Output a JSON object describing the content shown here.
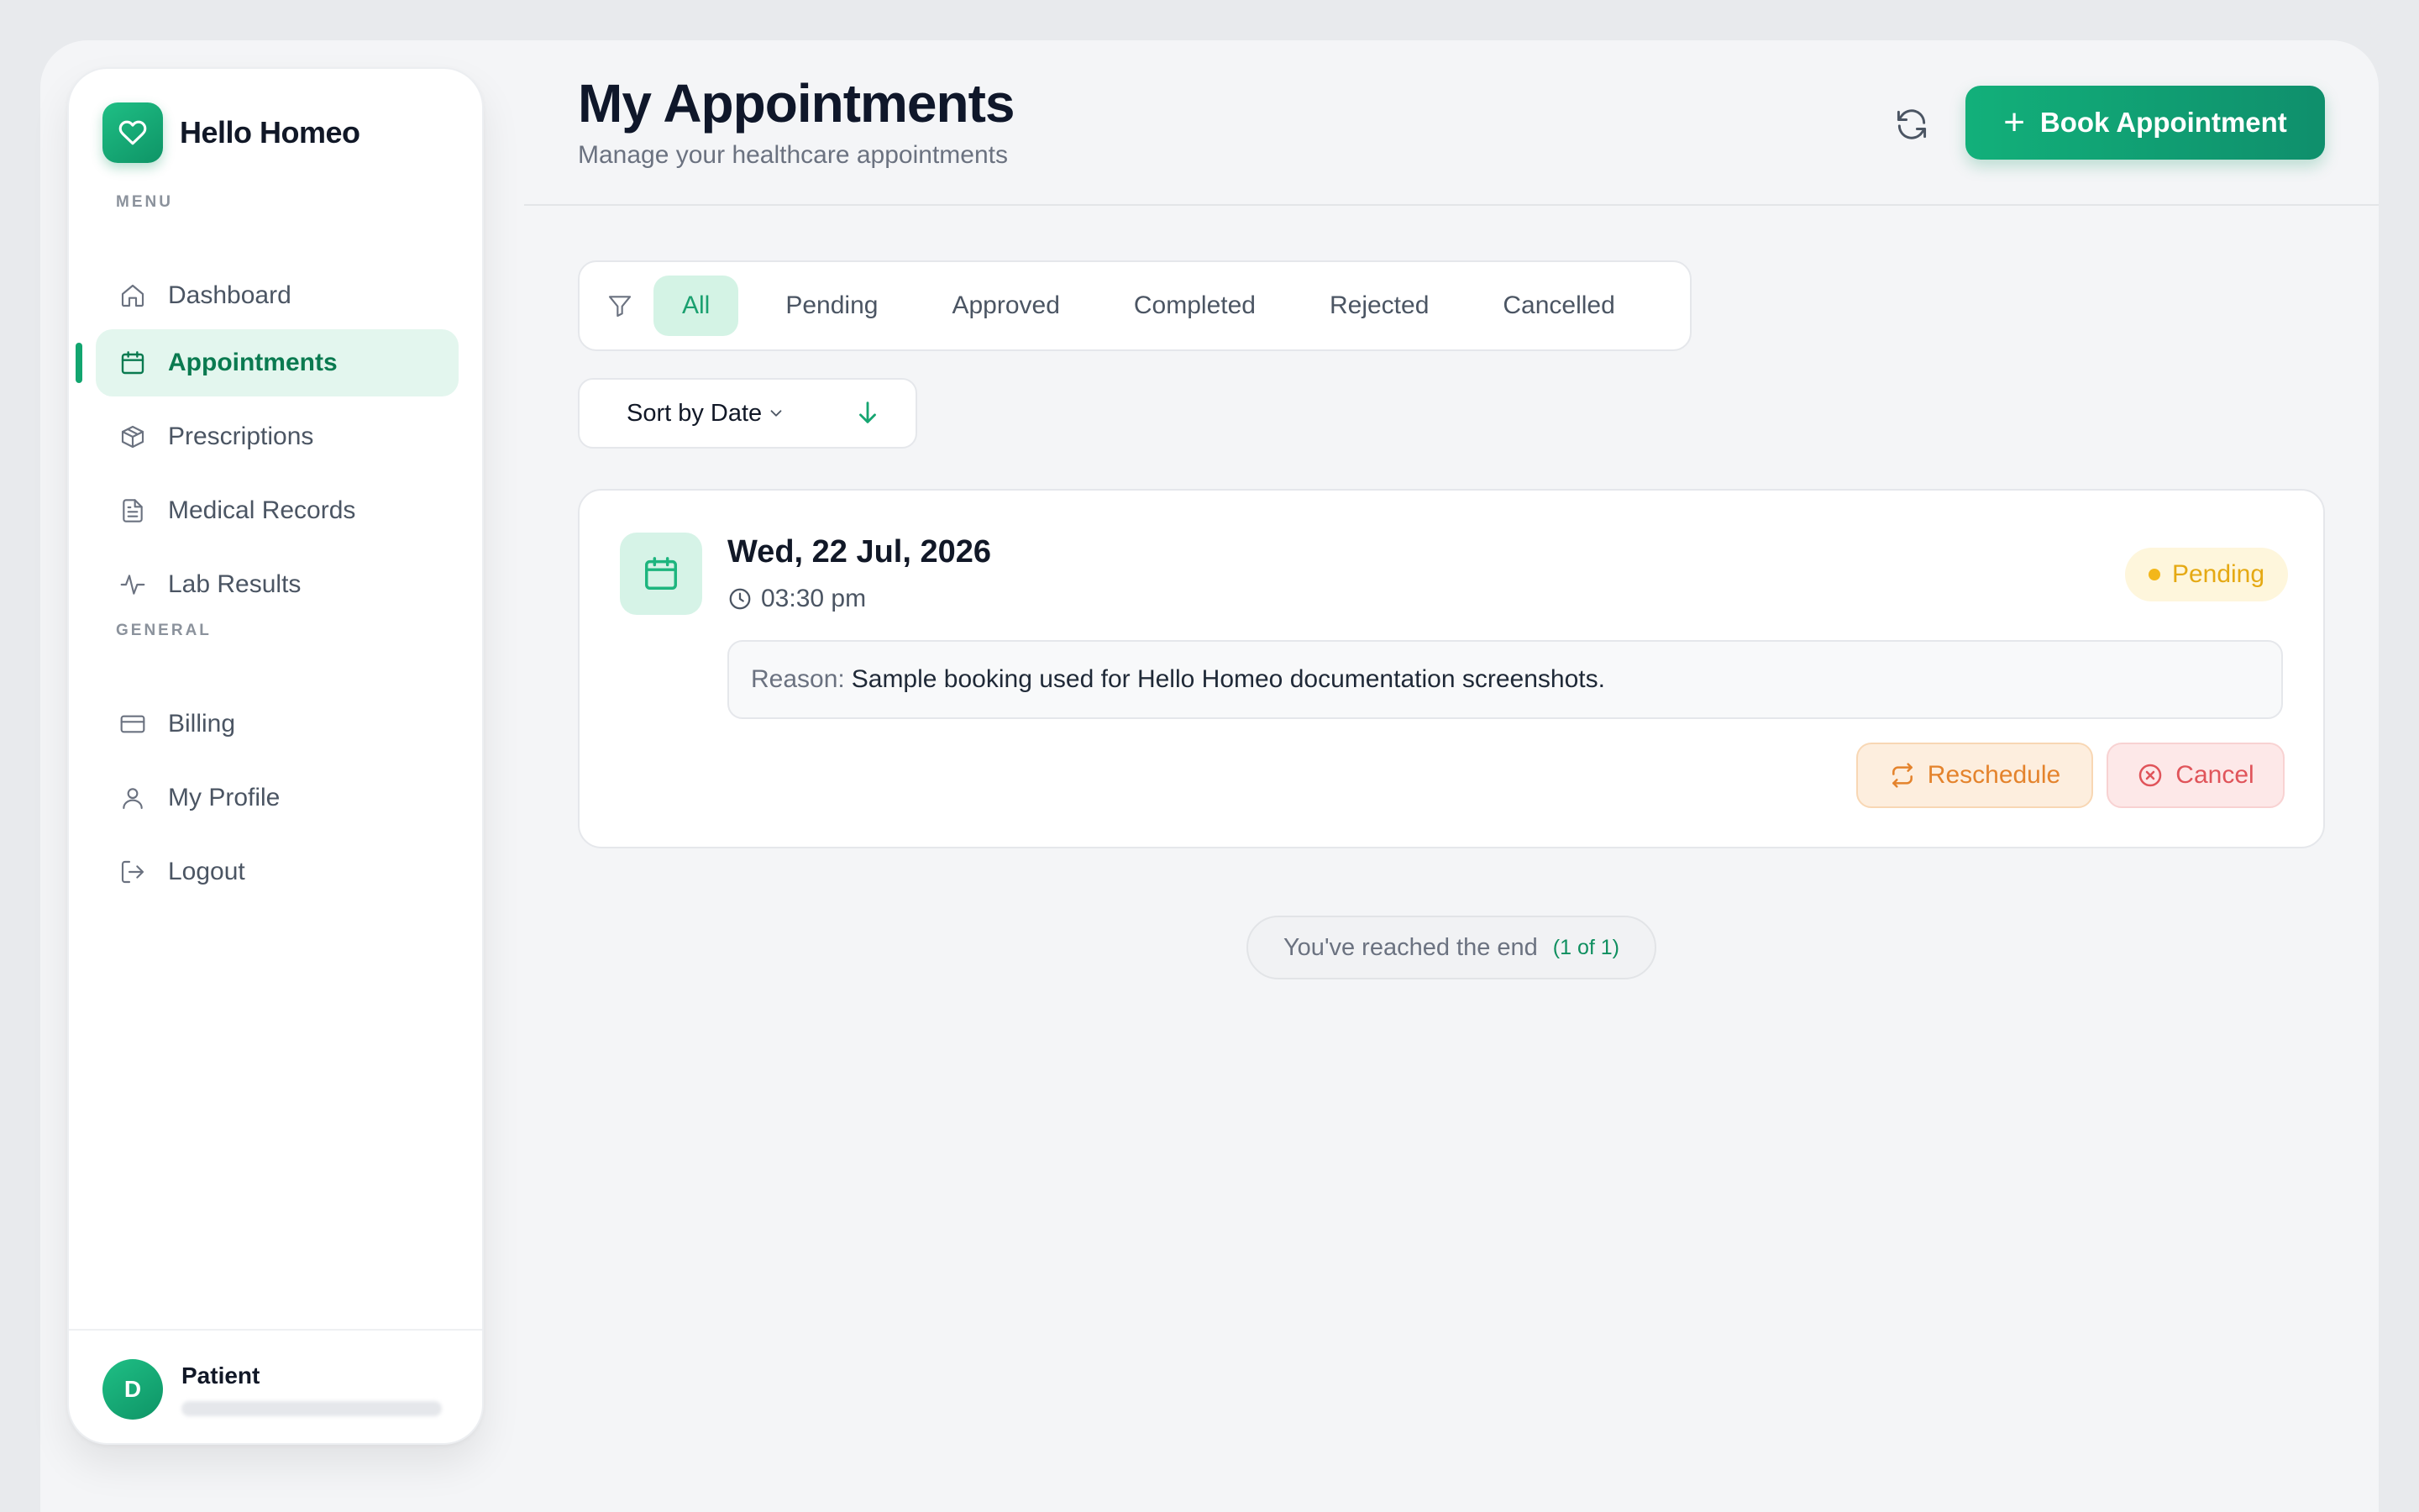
{
  "brand": {
    "name": "Hello Homeo",
    "icon": "heart-icon"
  },
  "sidebar": {
    "menu_label": "MENU",
    "general_label": "GENERAL",
    "menu_items": [
      {
        "label": "Dashboard",
        "icon": "home-icon"
      },
      {
        "label": "Appointments",
        "icon": "calendar-icon",
        "active": true
      },
      {
        "label": "Prescriptions",
        "icon": "box-icon"
      },
      {
        "label": "Medical Records",
        "icon": "document-icon"
      },
      {
        "label": "Lab Results",
        "icon": "activity-icon"
      }
    ],
    "general_items": [
      {
        "label": "Billing",
        "icon": "credit-card-icon"
      },
      {
        "label": "My Profile",
        "icon": "user-icon"
      },
      {
        "label": "Logout",
        "icon": "logout-icon"
      }
    ],
    "user": {
      "initial": "D",
      "role": "Patient"
    }
  },
  "header": {
    "title": "My Appointments",
    "subtitle": "Manage your healthcare appointments",
    "book_button": "Book Appointment"
  },
  "filters": {
    "tabs": [
      "All",
      "Pending",
      "Approved",
      "Completed",
      "Rejected",
      "Cancelled"
    ],
    "active_tab": "All"
  },
  "sort": {
    "label": "Sort by Date",
    "direction": "descending"
  },
  "appointments": [
    {
      "date": "Wed, 22 Jul, 2026",
      "time": "03:30 pm",
      "status": "Pending",
      "reason_label": "Reason:",
      "reason": "Sample booking used for Hello Homeo documentation screenshots.",
      "reschedule_label": "Reschedule",
      "cancel_label": "Cancel"
    }
  ],
  "end_message": {
    "text": "You've reached the end",
    "count": "(1 of 1)"
  },
  "colors": {
    "brand_green": "#12a56f",
    "active_bg": "#e3f6ee",
    "pending": "#e5a913",
    "reschedule": "#e4832c",
    "cancel": "#e0545a"
  }
}
